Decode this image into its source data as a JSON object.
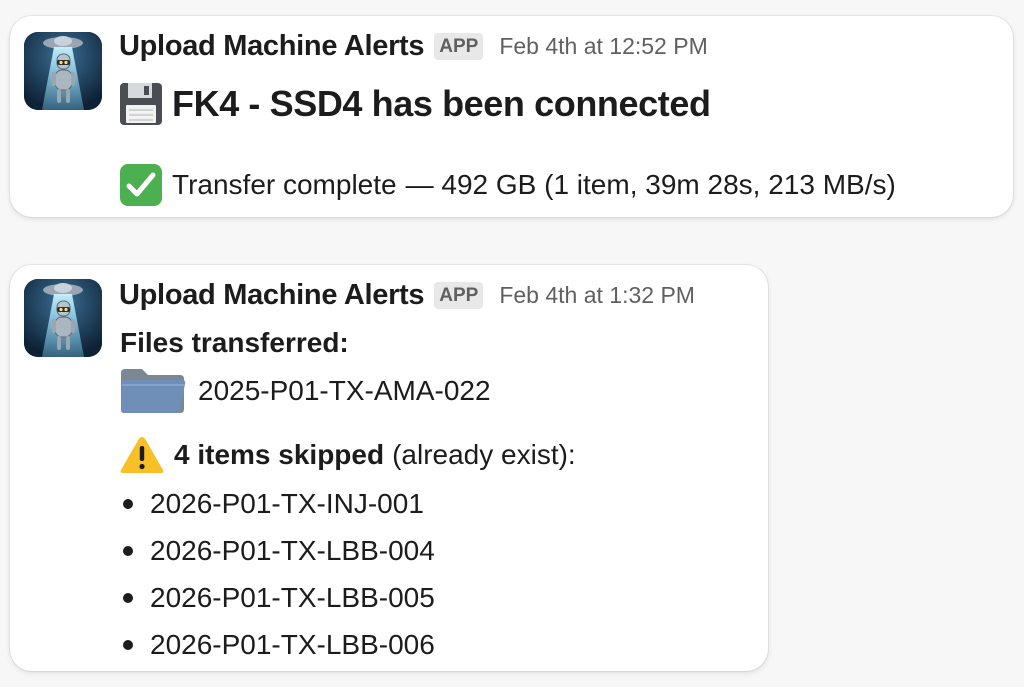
{
  "messages": [
    {
      "sender": "Upload Machine Alerts",
      "badge": "APP",
      "timestamp": "Feb 4th at 12:52 PM",
      "avatar_icon": "robot-ufo-icon",
      "headline": {
        "icon": "floppy-disk-icon",
        "text": "FK4 - SSD4 has been connected"
      },
      "status": {
        "icon": "check-mark-icon",
        "label": "Transfer complete",
        "detail": "— 492 GB (1 item, 39m 28s, 213 MB/s)"
      }
    },
    {
      "sender": "Upload Machine Alerts",
      "badge": "APP",
      "timestamp": "Feb 4th at 1:32 PM",
      "avatar_icon": "robot-ufo-icon",
      "files_title": "Files transferred:",
      "transferred": {
        "icon": "folder-icon",
        "name": "2025-P01-TX-AMA-022"
      },
      "skipped": {
        "icon": "warning-icon",
        "count_label": "4 items skipped",
        "reason": "(already exist):",
        "items": [
          "2026-P01-TX-INJ-001",
          "2026-P01-TX-LBB-004",
          "2026-P01-TX-LBB-005",
          "2026-P01-TX-LBB-006"
        ]
      }
    }
  ],
  "colors": {
    "text": "#1d1c1d",
    "muted": "#616061",
    "badge_bg": "#e8e8e8",
    "check_green": "#4caf50",
    "warning_yellow": "#f6c026",
    "folder_blue": "#6f8fb8"
  }
}
